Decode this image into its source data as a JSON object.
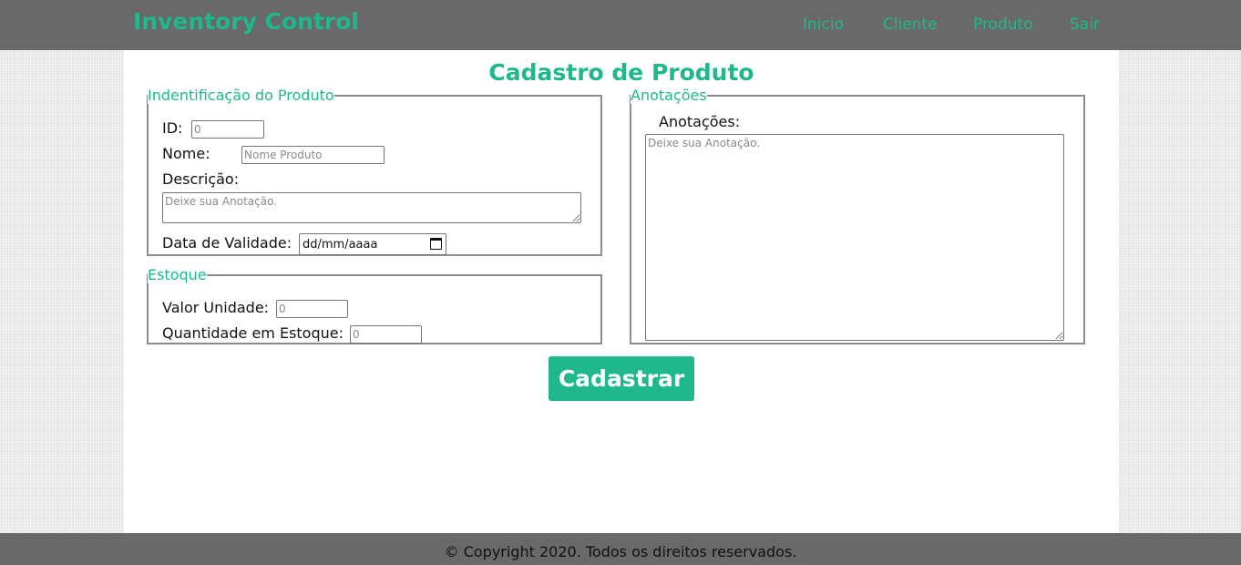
{
  "header": {
    "brand": "Inventory Control",
    "nav": [
      "Inicio",
      "Cliente",
      "Produto",
      "Sair"
    ]
  },
  "page": {
    "title": "Cadastro de Produto"
  },
  "identification": {
    "legend": "Indentificação do Produto",
    "id_label": "ID:",
    "id_placeholder": "0",
    "name_label": "Nome:",
    "name_placeholder": "Nome Produto",
    "description_label": "Descrição:",
    "description_placeholder": "Deixe sua Anotação.",
    "expiry_label": "Data de Validade:",
    "expiry_value": "dd/mm/aaaa"
  },
  "stock": {
    "legend": "Estoque",
    "unit_value_label": "Valor Unidade:",
    "unit_value_placeholder": "0",
    "quantity_label": "Quantidade em Estoque:",
    "quantity_placeholder": "0"
  },
  "notes": {
    "legend": "Anotações",
    "label": "Anotações:",
    "placeholder": "Deixe sua Anotação."
  },
  "actions": {
    "submit_label": "Cadastrar"
  },
  "footer": {
    "text": "© Copyright 2020. Todos os direitos reservados."
  },
  "colors": {
    "accent": "#1fb88c",
    "header_bg": "#696969",
    "content_bg": "#ffffff"
  }
}
